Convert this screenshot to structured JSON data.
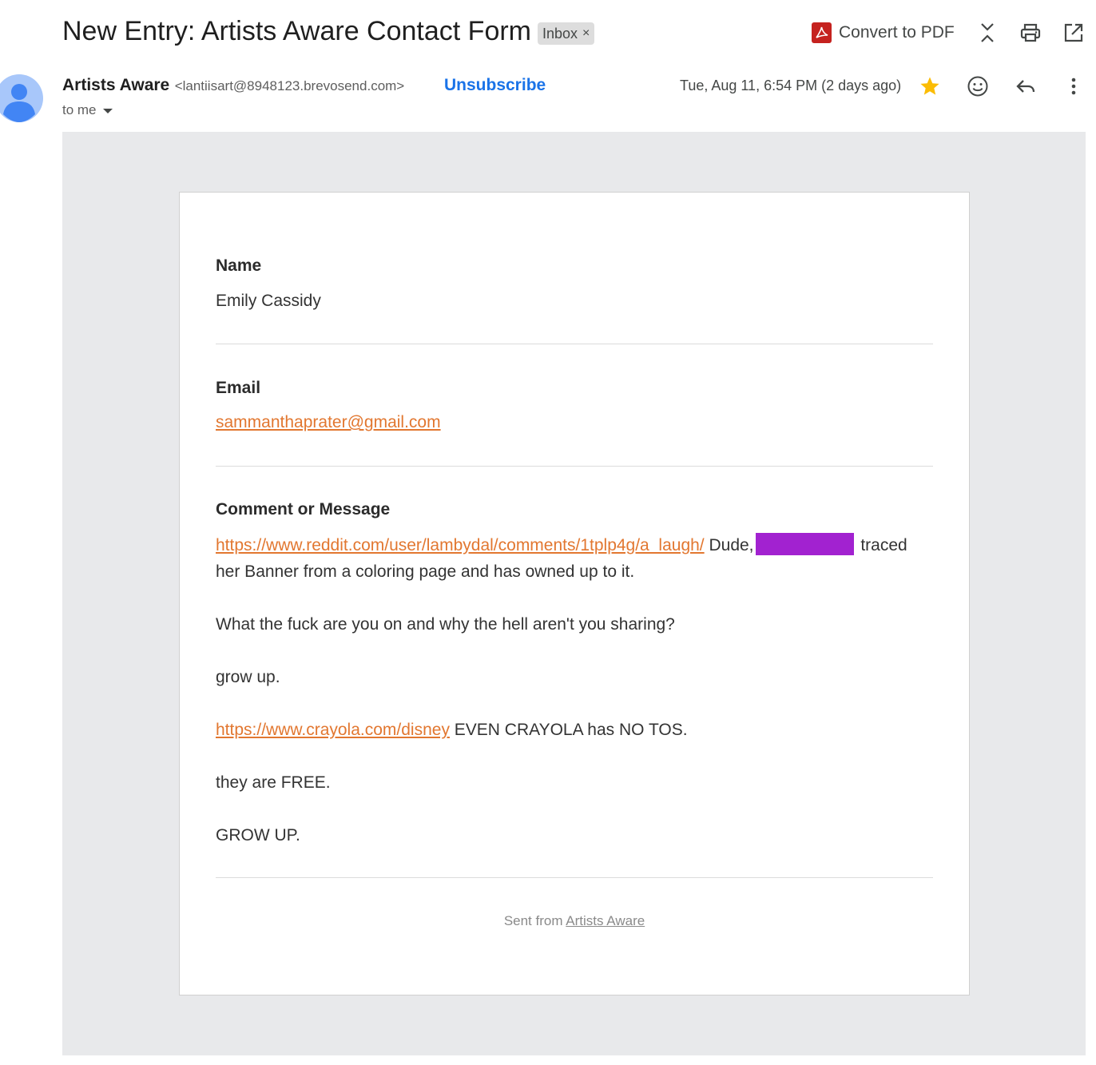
{
  "header": {
    "subject": "New Entry: Artists Aware Contact Form",
    "label_chip": "Inbox",
    "label_chip_close": "×",
    "convert_pdf": "Convert to PDF"
  },
  "message_header": {
    "sender_name": "Artists Aware",
    "sender_email": "<lantiisart@8948123.brevosend.com>",
    "unsubscribe": "Unsubscribe",
    "recipient": "to me",
    "date": "Tue, Aug 11, 6:54 PM (2 days ago)",
    "starred": true
  },
  "form": {
    "name_label": "Name",
    "name_value": "Emily Cassidy",
    "email_label": "Email",
    "email_value": "sammanthaprater@gmail.com",
    "message_label": "Comment or Message",
    "message": {
      "link1": "https://www.reddit.com/user/lambydal/comments/1tplp4g/a_laugh/",
      "text1a": " Dude,",
      "text1b": " traced her Banner from a coloring page and has owned up to it.",
      "p2": "What the fuck are you on and why the hell aren't you sharing?",
      "p3": "grow up.",
      "link2": "https://www.crayola.com/disney",
      "text4": " EVEN CRAYOLA has NO TOS.",
      "p5": "they are FREE.",
      "p6": "GROW UP."
    },
    "footer_prefix": "Sent from ",
    "footer_link": "Artists Aware"
  },
  "colors": {
    "link": "#e27730",
    "unsubscribe": "#1a73e8",
    "star": "#fbbc04",
    "redaction": "#a222d0",
    "panel_bg": "#e8e9eb"
  }
}
